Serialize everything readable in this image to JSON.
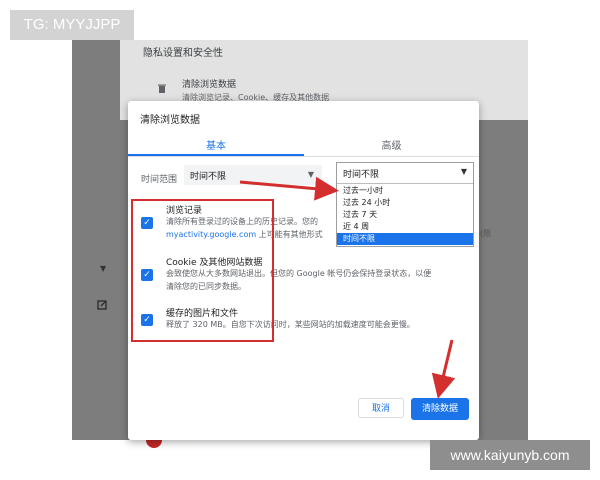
{
  "watermarks": {
    "top_left": "TG: MYYJJPP",
    "bottom_right": "www.kaiyunyb.com"
  },
  "background": {
    "section_title": "隐私设置和安全性",
    "clear_item_title": "清除浏览数据",
    "clear_item_desc": "清除浏览记录、Cookie、缓存及其他数据",
    "ghost_text": "(限"
  },
  "dialog": {
    "title": "清除浏览数据",
    "tabs": [
      {
        "label": "基本",
        "active": true
      },
      {
        "label": "高级",
        "active": false
      }
    ],
    "time_range_label": "时间范围",
    "time_range_value": "时间不限",
    "items": [
      {
        "title": "浏览记录",
        "desc_line1": "清除所有登录过的设备上的历史记录。您的",
        "desc_link": "myactivity.google.com",
        "desc_line2_suffix": " 上可能有其他形式",
        "checked": true
      },
      {
        "title": "Cookie 及其他网站数据",
        "desc_line1": "会致使您从大多数网站退出。但您的 Google 帐号仍会保持登录状态，以便",
        "desc_line2": "清除您的已同步数据。",
        "checked": true
      },
      {
        "title": "缓存的图片和文件",
        "desc_line1": "释放了 320 MB。自您下次访问时，某些网站的加载速度可能会更慢。",
        "checked": true
      }
    ],
    "cancel_label": "取消",
    "clear_label": "清除数据"
  },
  "dropdown": {
    "selected": "时间不限",
    "options": [
      "过去一小时",
      "过去 24 小时",
      "过去 7 天",
      "近 4 周",
      "时间不限"
    ],
    "selected_index": 4
  },
  "colors": {
    "accent": "#1a73e8",
    "annotation_red": "#d32f2f",
    "backdrop": "#7d7d7d"
  }
}
